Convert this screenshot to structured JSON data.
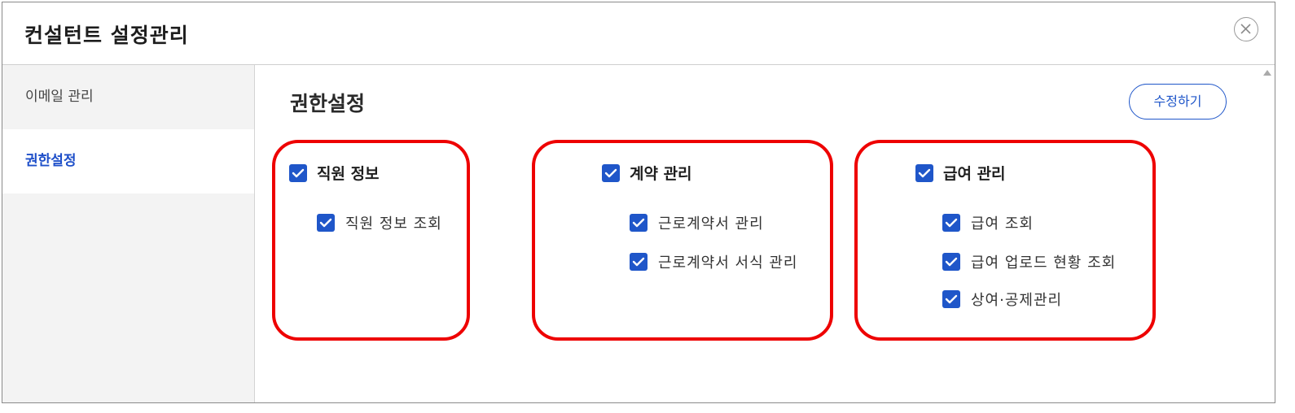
{
  "dialog": {
    "title": "컨설턴트 설정관리",
    "close_icon": "close-circle-icon"
  },
  "sidebar": {
    "items": [
      {
        "label": "이메일 관리",
        "active": false
      },
      {
        "label": "권한설정",
        "active": true
      }
    ]
  },
  "main": {
    "section_title": "권한설정",
    "edit_button": "수정하기",
    "accent_color": "#1f56c9",
    "highlight_color": "#ee0000",
    "groups": [
      {
        "label": "직원 정보",
        "checked": true,
        "children": [
          {
            "label": "직원 정보 조회",
            "checked": true
          }
        ]
      },
      {
        "label": "계약 관리",
        "checked": true,
        "children": [
          {
            "label": "근로계약서 관리",
            "checked": true
          },
          {
            "label": "근로계약서 서식 관리",
            "checked": true
          }
        ]
      },
      {
        "label": "급여 관리",
        "checked": true,
        "children": [
          {
            "label": "급여 조회",
            "checked": true
          },
          {
            "label": "급여 업로드 현황 조회",
            "checked": true
          },
          {
            "label": "상여·공제관리",
            "checked": true
          }
        ]
      }
    ]
  }
}
